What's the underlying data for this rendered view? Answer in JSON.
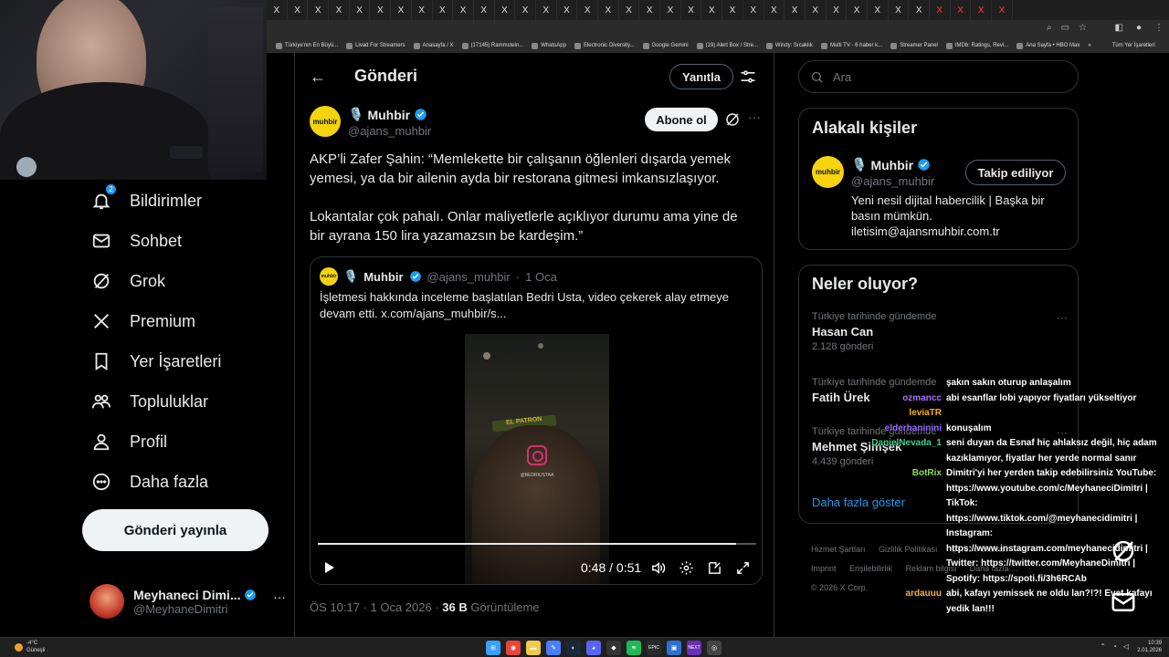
{
  "browser": {
    "tab_glyph": "X",
    "tab_count": 36,
    "red_tabs": [
      32,
      33,
      34,
      35
    ],
    "bookmarks": [
      "Türkiye'nin En Büyü...",
      "Livad For Streamers",
      "Anasayfa / X",
      "(17145) Rammstein...",
      "WhatsApp",
      "Electronic Diversity...",
      "Google Gemini",
      "(19) Alert Box / Stre...",
      "Windy: Sıcaklık",
      "Multi TV - 6 haber k...",
      "Streamer Panel",
      "IMDb: Ratings, Revi...",
      "Ana Sayfa • HBO Max"
    ],
    "bookmarks_more": "»",
    "all_bookmarks": "Tüm Yer İşaretleri"
  },
  "nav": {
    "items": [
      {
        "label": "Bildirimler",
        "icon": "bell-icon",
        "badge": "2"
      },
      {
        "label": "Sohbet",
        "icon": "mail-icon"
      },
      {
        "label": "Grok",
        "icon": "grok-icon"
      },
      {
        "label": "Premium",
        "icon": "x-logo-icon"
      },
      {
        "label": "Yer İşaretleri",
        "icon": "bookmark-icon"
      },
      {
        "label": "Topluluklar",
        "icon": "communities-icon"
      },
      {
        "label": "Profil",
        "icon": "profile-icon"
      },
      {
        "label": "Daha fazla",
        "icon": "more-circle-icon"
      }
    ],
    "post_button": "Gönderi yayınla",
    "account": {
      "name": "Meyhaneci Dimi...",
      "handle": "@MeyhaneDimitri",
      "more": "···"
    }
  },
  "header": {
    "title": "Gönderi",
    "back": "←",
    "reply_label": "Yanıtla"
  },
  "post": {
    "author_avatar_text": "muhbir",
    "author_emoji": "🎙️",
    "author_name": "Muhbir",
    "author_handle": "@ajans_muhbir",
    "follow_label": "Abone ol",
    "more": "···",
    "paragraphs": [
      "AKP’li Zafer Şahin: “Memlekette bir çalışanın öğlenleri dışarda yemek yemesi, ya da bir ailenin ayda bir restorana gitmesi imkansızlaşıyor.",
      "Lokantalar çok pahalı. Onlar maliyetlerle açıklıyor durumu ama yine de bir ayrana 150 lira yazamazsın be kardeşim.”"
    ],
    "quote": {
      "avatar_text": "muhbir",
      "name": "Muhbir",
      "handle": "@ajans_muhbir",
      "sep": "·",
      "date": "1 Oca",
      "text": "İşletmesi hakkında inceleme başlatılan Bedri Usta, video çekerek alay etmeye devam etti.  x.com/ajans_muhbir/s...",
      "video": {
        "cap_text": "EL PATRON",
        "insta_user": "@BEDRIUSTAA",
        "time": "0:48 / 0:51",
        "progress": 0.955
      }
    },
    "meta": {
      "time": "ÖS 10:17",
      "sep1": " · ",
      "date": "1 Oca 2026",
      "sep2": " · ",
      "views": "36 B",
      "views_label": " Görüntüleme"
    }
  },
  "right": {
    "search_placeholder": "Ara",
    "related": {
      "title": "Alakalı kişiler",
      "avatar_text": "muhbir",
      "emoji": "🎙️",
      "name": "Muhbir",
      "handle": "@ajans_muhbir",
      "button": "Takip ediliyor",
      "bio": "Yeni nesil dijital habercilik | Başka bir basın mümkün. iletisim@ajansmuhbir.com.tr"
    },
    "trends": {
      "title": "Neler oluyor?",
      "items": [
        {
          "context": "Türkiye tarihinde gündemde",
          "name": "Hasan Can",
          "count": "2.128 gönderi"
        },
        {
          "context": "Türkiye tarihinde gündemde",
          "name": "Fatih Ürek",
          "count": ""
        },
        {
          "context": "Türkiye tarihinde gündemde",
          "name": "Mehmet Şimşek",
          "count": "4.439 gönderi"
        }
      ],
      "show_more": "Daha fazla göster"
    },
    "footer": {
      "links_row1": [
        "Hizmet Şartları",
        "Gizlilik Politikası",
        "Çerez Politikası"
      ],
      "links_row2": [
        "Imprint",
        "Erişilebilirlik",
        "Reklam bilgisi",
        "Daha fazla ..."
      ],
      "copyright": "© 2026 X Corp."
    }
  },
  "chat": [
    {
      "user": "",
      "color": "#ffffff",
      "text": "şakın sakın oturup anlaşalım"
    },
    {
      "user": "ozmancc",
      "color": "#a970ff",
      "text": "abi esanflar lobi yapıyor fiyatları yükseltiyor"
    },
    {
      "user": "leviaTR",
      "color": "#ffb000",
      "text": ""
    },
    {
      "user": "elderhaninini",
      "color": "#9b6bff",
      "text": "konuşalım"
    },
    {
      "user": "DanielNevada_1",
      "color": "#3fd18f",
      "text": "seni duyan da Esnaf hiç ahlaksız değil, hiç adam kazıklamıyor, fiyatlar her yerde normal sanır"
    },
    {
      "user": "BotRix",
      "color": "#8fe04a",
      "text": "Dimitri'yi her yerden takip edebilirsiniz YouTube: https://www.youtube.com/c/MeyhaneciDimitri | TikTok: https://www.tiktok.com/@meyhanecidimitri | Instagram: https://www.instagram.com/meyhanecidimitri | Twitter: https://twitter.com/MeyhaneDimitri | Spotify: https://spoti.fi/3h6RCAb"
    },
    {
      "user": "ardauuu",
      "color": "#f5b041",
      "text": "abi, kafayı yemissek ne oldu lan?!?! Evet kafayı yedik lan!!!"
    }
  ],
  "taskbar": {
    "weather_temp": "-4°C",
    "weather_desc": "Güneşli",
    "clock_time": "10:39",
    "clock_date": "2.01.2026",
    "app_icons": [
      {
        "name": "windows-start-icon",
        "color": "#3aa0ff",
        "glyph": "⊞"
      },
      {
        "name": "chrome-icon",
        "color": "#e8453c",
        "glyph": "◉"
      },
      {
        "name": "file-explorer-icon",
        "color": "#f2c94c",
        "glyph": "▬"
      },
      {
        "name": "editor-icon",
        "color": "#4a7dff",
        "glyph": "✎"
      },
      {
        "name": "steam-icon",
        "color": "#1b2838",
        "glyph": "◐"
      },
      {
        "name": "discord-icon",
        "color": "#5865f2",
        "glyph": "◕"
      },
      {
        "name": "app-icon",
        "color": "#333333",
        "glyph": "◆"
      },
      {
        "name": "spotify-icon",
        "color": "#1db954",
        "glyph": "≋"
      },
      {
        "name": "epic-icon",
        "color": "#2a2a2a",
        "glyph": "EPIC"
      },
      {
        "name": "app-icon-2",
        "color": "#2f6fd0",
        "glyph": "▣"
      },
      {
        "name": "kick-icon",
        "color": "#6b2fb3",
        "glyph": "NEXT"
      },
      {
        "name": "obs-icon",
        "color": "#444444",
        "glyph": "◎"
      }
    ]
  }
}
